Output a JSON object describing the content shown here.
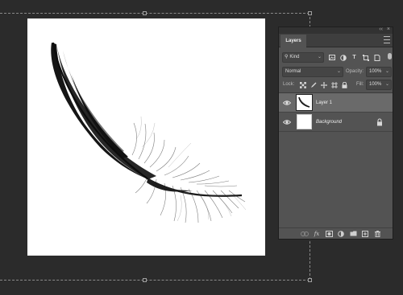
{
  "canvas": {
    "background": "#ffffff",
    "content": "black-feather-icon"
  },
  "panel": {
    "tab_label": "Layers",
    "filter": {
      "kind_label": "Kind",
      "icons": [
        "image-filter-icon",
        "adjustment-filter-icon",
        "type-filter-icon",
        "shape-filter-icon",
        "smart-object-filter-icon"
      ]
    },
    "blend": {
      "mode": "Normal",
      "opacity_label": "Opacity:",
      "opacity_value": "100%"
    },
    "lock": {
      "label": "Lock:",
      "icons": [
        "lock-transparency-icon",
        "lock-image-icon",
        "lock-position-icon",
        "lock-artboard-icon",
        "lock-all-icon"
      ],
      "fill_label": "Fill:",
      "fill_value": "100%"
    },
    "layers": [
      {
        "name": "Layer 1",
        "selected": true,
        "visible": true,
        "locked": false
      },
      {
        "name": "Background",
        "selected": false,
        "visible": true,
        "locked": true
      }
    ],
    "footer_icons": [
      "link-layers-icon",
      "fx-icon",
      "add-mask-icon",
      "adjustment-layer-icon",
      "new-group-icon",
      "new-layer-icon",
      "delete-icon"
    ]
  },
  "colors": {
    "workspace": "#2b2b2b",
    "panel": "#535353",
    "selected_row": "#6a6a6a"
  }
}
